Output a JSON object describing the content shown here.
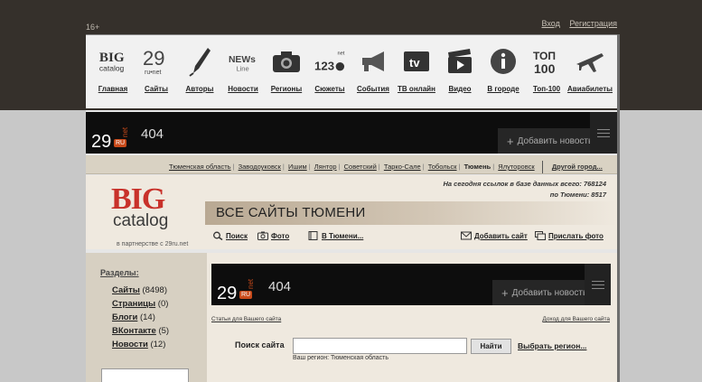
{
  "top": {
    "age": "16+",
    "login": "Вход",
    "register": "Регистрация"
  },
  "nav": [
    {
      "label": "Главная",
      "icon": "bigcatalog-icon"
    },
    {
      "label": "Сайты",
      "icon": "29ru-net-icon"
    },
    {
      "label": "Авторы",
      "icon": "fountain-pen-icon"
    },
    {
      "label": "Новости",
      "icon": "news-line-icon"
    },
    {
      "label": "Регионы",
      "icon": "camera-icon"
    },
    {
      "label": "Сюжеты",
      "icon": "123ru-net-icon"
    },
    {
      "label": "События",
      "icon": "megaphone-icon"
    },
    {
      "label": "ТВ онлайн",
      "icon": "tv-icon"
    },
    {
      "label": "Видео",
      "icon": "clapperboard-icon"
    },
    {
      "label": "В городе",
      "icon": "info-icon"
    },
    {
      "label": "Топ-100",
      "icon": "top100-icon"
    },
    {
      "label": "Авиабилеты",
      "icon": "airplane-icon"
    }
  ],
  "banner": {
    "logo": "29",
    "net": "net",
    "ru": "RU",
    "error": "404",
    "add_news": "Добавить новость"
  },
  "cities": {
    "items": [
      "Тюменская область",
      "Заводоуковск",
      "Ишим",
      "Лянтор",
      "Советский",
      "Тарко-Сале",
      "Тобольск"
    ],
    "current": "Тюмень",
    "after": [
      "Ялуторовск"
    ],
    "other": "Другой город..."
  },
  "header": {
    "logo_big": "BIG",
    "logo_catalog": "catalog",
    "partner": "в партнерстве с 29ru.net",
    "stats_line1": "На сегодня ссылок в базе данных всего: 768124",
    "stats_line2": "по Тюмени: 8517",
    "all_sites": "ВСЕ САЙТЫ ТЮМЕНИ",
    "links": {
      "search": "Поиск",
      "photo": "Фото",
      "in_tyumen": "В Тюмени...",
      "add_site": "Добавить сайт",
      "send_photo": "Прислать фото"
    }
  },
  "sections": {
    "title": "Разделы:",
    "items": [
      {
        "name": "Сайты",
        "count": "(8498)"
      },
      {
        "name": "Страницы",
        "count": "(0)"
      },
      {
        "name": "Блоги",
        "count": "(14)"
      },
      {
        "name": "ВКонтакте",
        "count": "(5)"
      },
      {
        "name": "Новости",
        "count": "(12)"
      }
    ]
  },
  "content": {
    "stats_link": "Статьи для Вашего сайта",
    "income_link": "Доход для Вашего сайта",
    "search_label": "Поиск сайта",
    "search_value": "",
    "search_button": "Найти",
    "choose_region": "Выбрать регион...",
    "your_region": "Ваш регион: Тюменская область"
  },
  "colors": {
    "topbar": "#35302b",
    "accent_red": "#c8312a",
    "ru_orange": "#c84a1a"
  }
}
